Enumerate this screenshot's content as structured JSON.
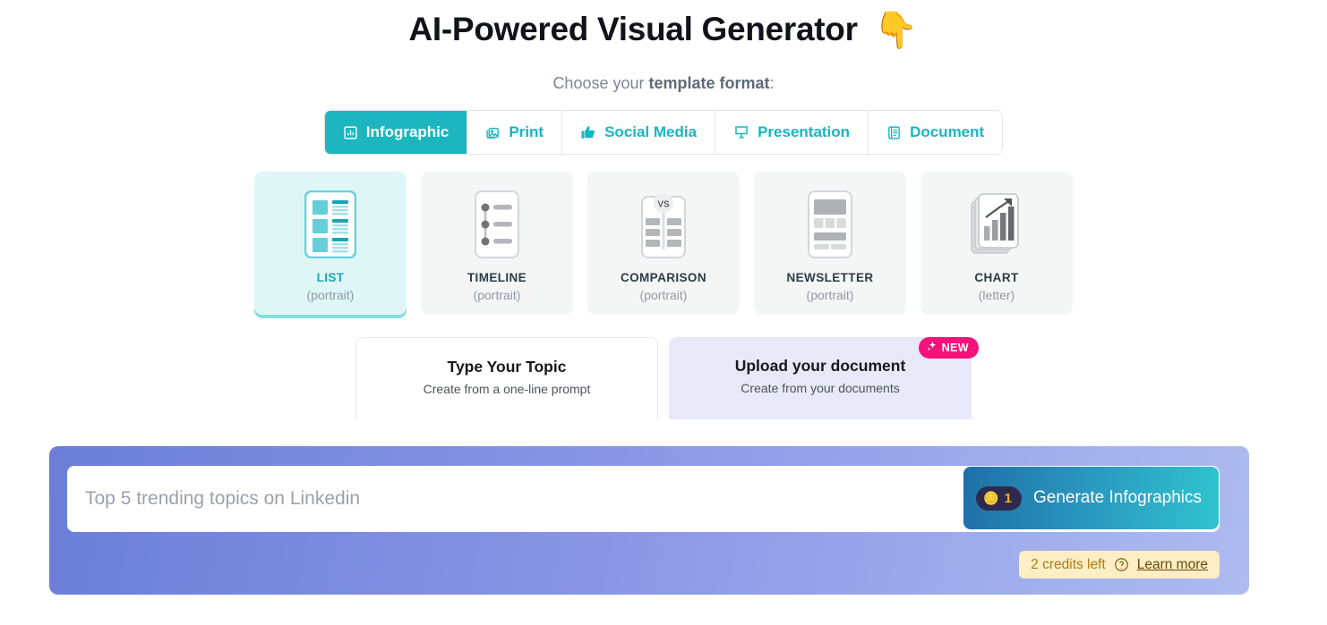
{
  "header": {
    "title": "AI-Powered Visual Generator",
    "pointer_emoji": "👇",
    "subtitle_prefix": "Choose your ",
    "subtitle_bold": "template format",
    "subtitle_suffix": ":"
  },
  "format_tabs": [
    {
      "label": "Infographic",
      "icon": "bar-chart-icon",
      "active": true
    },
    {
      "label": "Print",
      "icon": "photos-icon",
      "active": false
    },
    {
      "label": "Social Media",
      "icon": "thumbs-up-icon",
      "active": false
    },
    {
      "label": "Presentation",
      "icon": "projector-screen-icon",
      "active": false
    },
    {
      "label": "Document",
      "icon": "document-lines-icon",
      "active": false
    }
  ],
  "templates": [
    {
      "name": "LIST",
      "orientation": "(portrait)",
      "icon": "list-layout-icon",
      "selected": true
    },
    {
      "name": "TIMELINE",
      "orientation": "(portrait)",
      "icon": "timeline-layout-icon",
      "selected": false
    },
    {
      "name": "COMPARISON",
      "orientation": "(portrait)",
      "icon": "comparison-layout-icon",
      "selected": false
    },
    {
      "name": "NEWSLETTER",
      "orientation": "(portrait)",
      "icon": "newsletter-layout-icon",
      "selected": false
    },
    {
      "name": "CHART",
      "orientation": "(letter)",
      "icon": "chart-layout-icon",
      "selected": false
    }
  ],
  "modes": {
    "type_topic": {
      "title": "Type Your Topic",
      "subtitle": "Create from a one-line prompt"
    },
    "upload_document": {
      "title": "Upload your document",
      "subtitle": "Create from your documents",
      "badge": "NEW",
      "badge_icon": "sparkles-icon"
    }
  },
  "prompt": {
    "placeholder": "Top 5 trending topics on Linkedin",
    "value": "",
    "generate_label": "Generate Infographics",
    "coin_icon": "🪙",
    "coin_cost": "1"
  },
  "credits": {
    "text": "2 credits left",
    "help_icon": "question-circle-icon",
    "learn_more": "Learn more"
  },
  "colors": {
    "accent_teal": "#1bb6bf",
    "selected_card_bg": "#dff6f7",
    "panel_gradient_start": "#6a7ed8",
    "panel_gradient_end": "#aebbf0",
    "new_badge_pink": "#f5127a",
    "credits_bg": "#fdeec6",
    "coin_gold": "#f0b429"
  }
}
